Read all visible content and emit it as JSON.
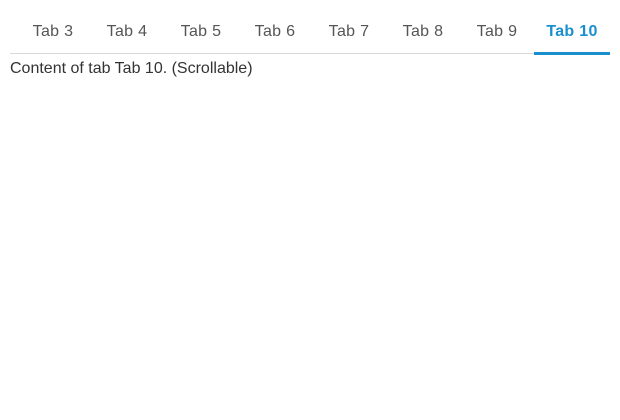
{
  "tabs": [
    {
      "label": "Tab 3"
    },
    {
      "label": "Tab 4"
    },
    {
      "label": "Tab 5"
    },
    {
      "label": "Tab 6"
    },
    {
      "label": "Tab 7"
    },
    {
      "label": "Tab 8"
    },
    {
      "label": "Tab 9"
    },
    {
      "label": "Tab 10",
      "active": true
    }
  ],
  "content": {
    "text": "Content of tab Tab 10. (Scrollable)"
  },
  "colors": {
    "accent": "#1a8fd0",
    "tab_text": "#555555",
    "content_text": "#333333",
    "divider": "#d9d9d9"
  }
}
